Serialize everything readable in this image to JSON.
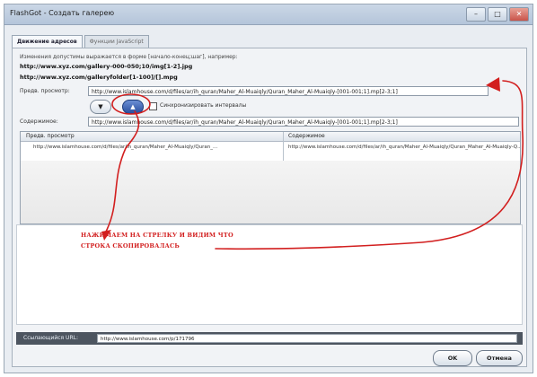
{
  "window": {
    "title": "FlashGot - Создать галерею"
  },
  "tabs": [
    {
      "label": "Движение адресов",
      "active": true
    },
    {
      "label": "Функции JavaScript",
      "active": false
    }
  ],
  "form": {
    "info_text": "Изменения допустимы выражается в форме [начало-конец;шаг], например:",
    "example_1": "http://www.xyz.com/gallery-000-050;10/img[1-2].jpg",
    "example_2": "http://www.xyz.com/galleryfolder[1-100]/[].mpg",
    "preview_label": "Предв. просмотр:",
    "preview_value": "http://www.islamhouse.com/d/files/ar/ih_quran/Maher_Al-Muaiqly/Quran_Maher_Al-Muaiqly-[001-001;1].mp[2-3;1]",
    "down_arrow": "▼",
    "up_arrow": "▲",
    "sync_label": "Синхронизировать интервалы",
    "content_label": "Содержимое:",
    "content_value": "http://www.islamhouse.com/d/files/ar/ih_quran/Maher_Al-Muaiqly/Quran_Maher_Al-Muaiqly-[001-001;1].mp[2-3;1]"
  },
  "list": {
    "columns": [
      "Предв. просмотр",
      "Содержимое"
    ],
    "rows": [
      [
        "http://www.islamhouse.com/d/files/ar/ih_quran/Maher_Al-Muaiqly/Quran_...",
        "http://www.islamhouse.com/d/files/ar/ih_quran/Maher_Al-Muaiqly/Quran_Maher_Al-Muaiqly-Q..."
      ]
    ]
  },
  "annotation": {
    "line_1": "НАЖИМАЕМ НА СТРЕЛКУ И ВИДИМ ЧТО",
    "line_2": "СТРОКА СКОПИРОВАЛАСЬ",
    "color": "#d21f1f"
  },
  "footer": {
    "referrer_label": "Ссылающийся URL:",
    "referrer_value": "http://www.islamhouse.com/p/171796",
    "ok_label": "OK",
    "cancel_label": "Отмена"
  }
}
